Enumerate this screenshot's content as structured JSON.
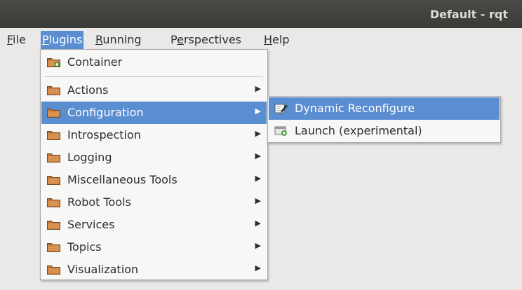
{
  "window": {
    "title": "Default - rqt"
  },
  "menubar": {
    "items": [
      {
        "mnemonic": "F",
        "rest": "ile"
      },
      {
        "mnemonic": "P",
        "rest": "lugins"
      },
      {
        "mnemonic": "R",
        "rest": "unning"
      },
      {
        "pre": "P",
        "mnemonic": "e",
        "rest": "rspectives"
      },
      {
        "mnemonic": "H",
        "rest": "elp"
      }
    ]
  },
  "plugins_menu": {
    "items": [
      "Container",
      "Actions",
      "Configuration",
      "Introspection",
      "Logging",
      "Miscellaneous Tools",
      "Robot Tools",
      "Services",
      "Topics",
      "Visualization"
    ]
  },
  "configuration_submenu": {
    "items": [
      "Dynamic Reconfigure",
      "Launch (experimental)"
    ]
  },
  "icons": {
    "folder": "folder-icon",
    "container": "folder-plus-icon",
    "dynamic_reconfigure": "edit-icon",
    "launch": "launch-plugin-icon",
    "submenu": "submenu-arrow-icon"
  },
  "colors": {
    "highlight": "#5b8ed0",
    "titlebar": "#3f3f3c",
    "menu_background": "#f7f7f6",
    "window_background": "#eae9e7"
  }
}
